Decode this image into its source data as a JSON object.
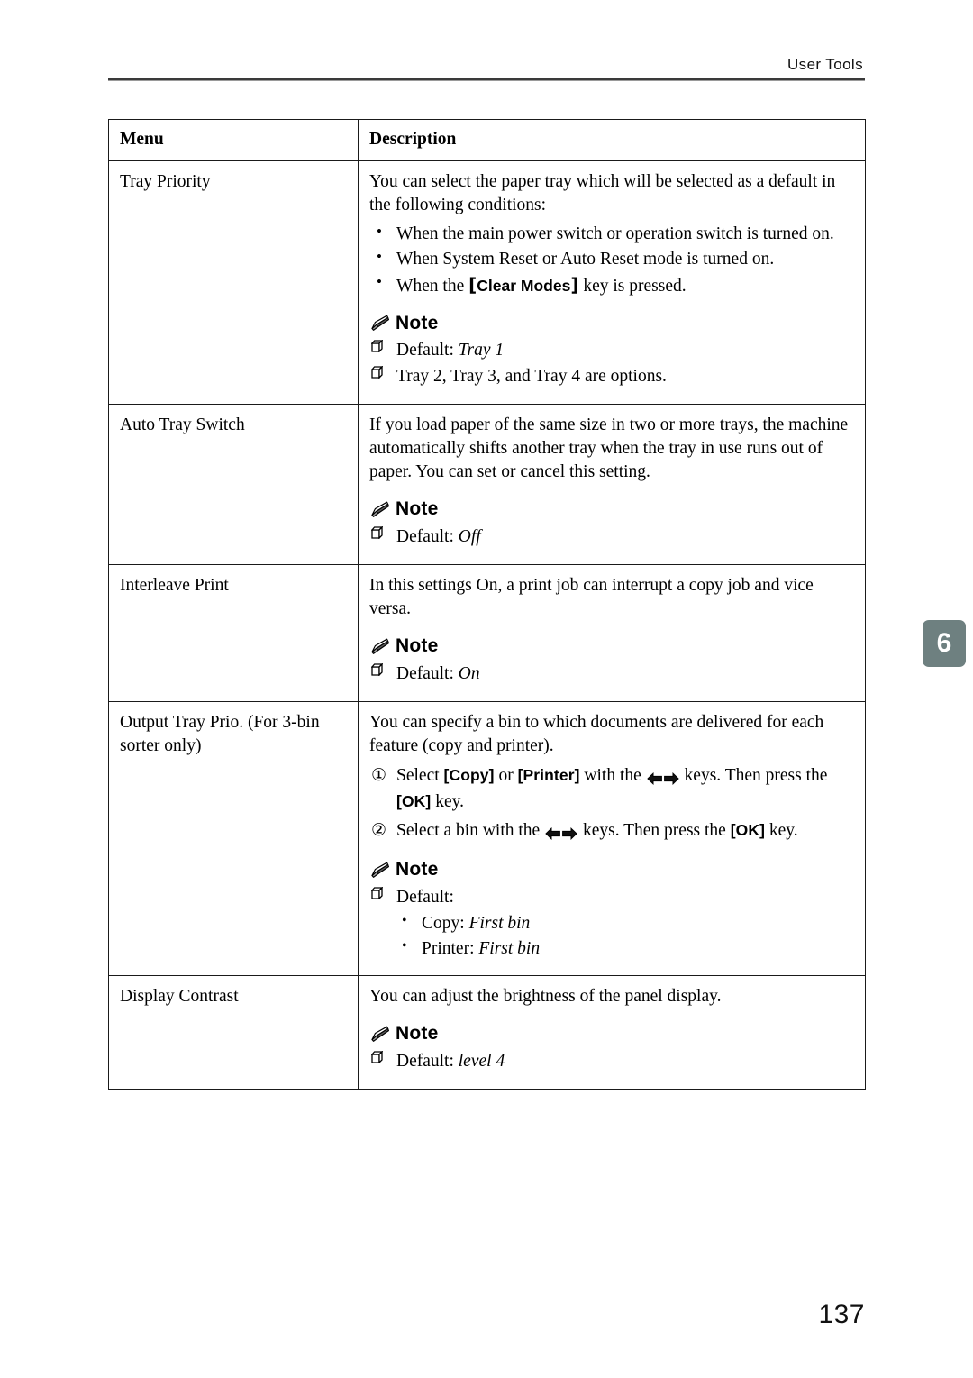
{
  "header": {
    "running_title": "User Tools"
  },
  "chapter_tab": {
    "number": "6"
  },
  "footer": {
    "page_number": "137"
  },
  "table": {
    "columns": [
      {
        "label": "Menu"
      },
      {
        "label": "Description"
      }
    ],
    "rows": [
      {
        "menu": "Tray Priority",
        "intro": "You can select the paper tray which will be selected as a default in the following conditions:",
        "bullets": [
          {
            "pre": "When the main power switch or operation switch is turned on.",
            "key": "",
            "post": ""
          },
          {
            "pre": "When System Reset or Auto Reset mode is turned on.",
            "key": "",
            "post": ""
          },
          {
            "pre": "When the ",
            "key": "Clear Modes",
            "post": " key is pressed."
          }
        ],
        "note_label": "Note",
        "note_items": [
          {
            "text": "Default: ",
            "emphasis": "Tray 1"
          },
          {
            "text": "Tray 2, Tray 3, and Tray 4 are options.",
            "emphasis": ""
          }
        ]
      },
      {
        "menu": "Auto Tray Switch",
        "intro": "If you load paper of the same size in two or more trays, the machine automatically shifts another tray when the tray in use runs out of paper. You can set or cancel this setting.",
        "note_label": "Note",
        "note_items": [
          {
            "text": "Default: ",
            "emphasis": "Off"
          }
        ]
      },
      {
        "menu": "Interleave Print",
        "intro": "In this settings On, a print job can interrupt a copy job and vice versa.",
        "note_label": "Note",
        "note_items": [
          {
            "text": "Default: ",
            "emphasis": "On"
          }
        ]
      },
      {
        "menu": "Output Tray Prio. (For 3-bin sorter only)",
        "intro": "You can specify a bin to which documents are delivered for each feature (copy and printer).",
        "steps": [
          {
            "marker": "①",
            "seg1": "Select ",
            "key1": "Copy",
            "seg2": " or ",
            "key2": "Printer",
            "seg3": " with the ",
            "seg4": " keys. Then press the ",
            "key3": "OK",
            "seg5": " key."
          },
          {
            "marker": "②",
            "seg1": "Select a bin with the ",
            "key1": "",
            "seg2": "",
            "key2": "",
            "seg3": "",
            "seg4": " keys. Then press the ",
            "key3": "OK",
            "seg5": " key."
          }
        ],
        "note_label": "Note",
        "note_items": [
          {
            "text": "Default:",
            "emphasis": ""
          }
        ],
        "note_subbullets": [
          {
            "text": "Copy: ",
            "emphasis": "First bin"
          },
          {
            "text": "Printer: ",
            "emphasis": "First bin"
          }
        ]
      },
      {
        "menu": "Display Contrast",
        "intro": "You can adjust the brightness of the panel display.",
        "note_label": "Note",
        "note_items": [
          {
            "text": "Default: ",
            "emphasis": "level 4"
          }
        ]
      }
    ]
  },
  "colors": {
    "tab_background": "#6e8080",
    "tab_text": "#ffffff",
    "rule": "#3a3a3a",
    "table_border": "#1a1a1a"
  }
}
